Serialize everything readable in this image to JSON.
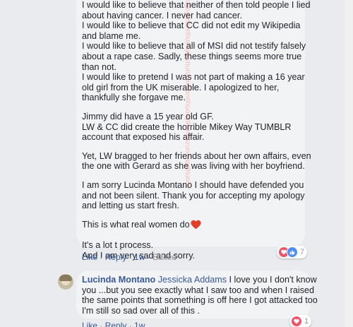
{
  "comment1": {
    "paragraphs": [
      [
        "I would like to believe that neither of then told people I lied",
        "about having cancer. I never had cancer.",
        "I would like to believe that CC did not edit my Wikipedia",
        "and blame me.",
        "I would like to believe that all of MSI did not testify falsely",
        "about a rape case. Sadly, these things seems more true",
        "than not.",
        "I would like to pretend I was not part of making a 16 year",
        "old girl from the UK miserable. I apologized to her,",
        "thankfully she forgave me."
      ],
      [
        "Jimmy did have a 15 year old GF.",
        "LW & CC did create the horrible Mikey Way TUMBLR",
        "account that exposed his affair."
      ],
      [
        "Yet, LW bragged to her friends about her own affairs, even",
        "the one with Gerard as she was living with her boyfriend."
      ],
      [
        "I am sorry Lucinda Montano I should have defended you",
        "and not been silent. Thank you for accepting my apology",
        "and letting us start fresh."
      ],
      [
        "This is what real women do"
      ],
      [
        "It's a lot t process.",
        "And I am very sad and sorry."
      ]
    ],
    "actions": {
      "like": "Like",
      "reply": "Reply",
      "time": "1w",
      "edited": "Edited"
    },
    "reactions": {
      "icons": [
        "love-icon",
        "like-icon"
      ],
      "count": "7"
    }
  },
  "comment2": {
    "author": "Lucinda Montano",
    "mention": "Jessicka Addams",
    "first_line_text": " I love you I don't know",
    "lines": [
      "you ...but you see exactly what I saw too and when I raised",
      "the same points that something is off here I got attacked too",
      "I'm still so sad over all of this ."
    ],
    "actions": {
      "like": "Like",
      "reply": "Reply",
      "time": "1w"
    },
    "reactions": {
      "icons": [
        "love-icon"
      ],
      "count": "1"
    }
  },
  "watermark": "ugnylvlanrlhuohylkshunzuoJianrlhuohylkshunzuoJianrlhuohy",
  "colors": {
    "link": "#385898",
    "bubble": "#f2f3f5",
    "background": "#e9ebee",
    "heart": "#f25268"
  }
}
